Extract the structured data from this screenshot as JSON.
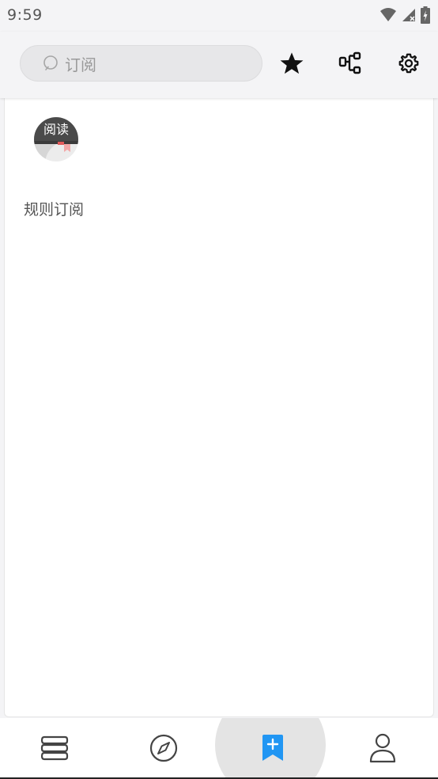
{
  "status_bar": {
    "time": "9:59"
  },
  "toolbar": {
    "search_placeholder": "订阅",
    "actions": [
      {
        "icon": "star-icon"
      },
      {
        "icon": "rule-tree-icon"
      },
      {
        "icon": "gear-icon"
      }
    ]
  },
  "subscriptions": [
    {
      "name": "规则订阅",
      "logo_text": "阅读"
    }
  ],
  "bottom_nav": {
    "items": [
      {
        "icon": "bookshelf-icon",
        "active": false
      },
      {
        "icon": "compass-icon",
        "active": false
      },
      {
        "icon": "subscribe-bookmark-icon",
        "active": true
      },
      {
        "icon": "person-icon",
        "active": false
      }
    ]
  },
  "colors": {
    "accent": "#2196f3",
    "icon": "#444444",
    "background": "#f4f4f6"
  }
}
